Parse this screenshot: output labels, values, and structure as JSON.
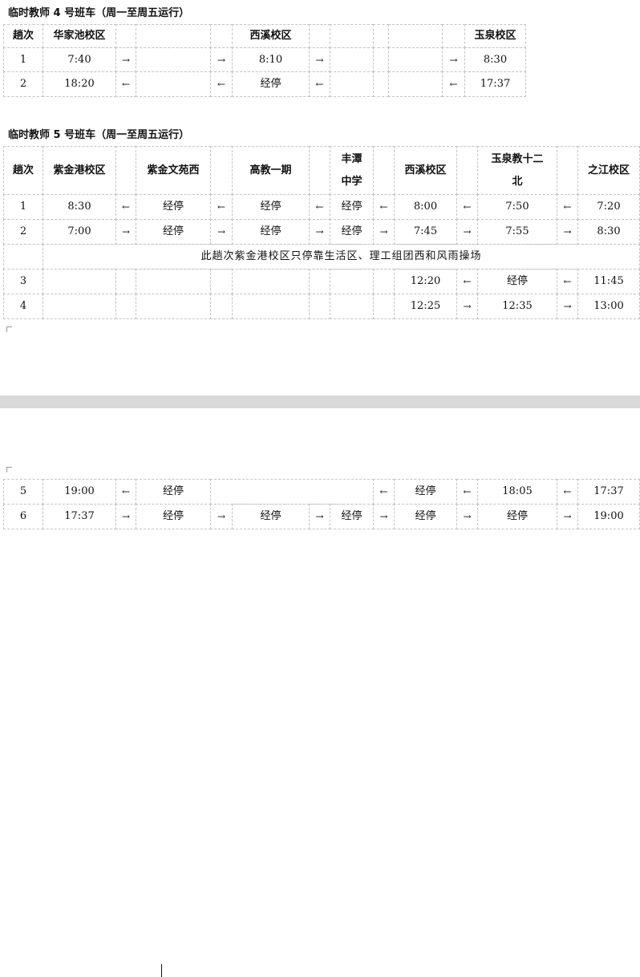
{
  "bus4": {
    "title": "临时教师 4 号班车（周一至周五运行）",
    "header": {
      "trip": "趟次",
      "stop1": "华家池校区",
      "stop2": "西溪校区",
      "stop3": "玉泉校区"
    },
    "rows": [
      {
        "trip": "1",
        "stop1": "7:40",
        "a1": "→",
        "a2": "→",
        "stop2": "8:10",
        "a3": "→",
        "a4": "→",
        "stop3": "8:30"
      },
      {
        "trip": "2",
        "stop1": "18:20",
        "a1": "←",
        "a2": "←",
        "stop2": "经停",
        "a3": "←",
        "a4": "←",
        "stop3": "17:37"
      }
    ]
  },
  "bus5": {
    "title": "临时教师 5 号班车（周一至周五运行）",
    "header": {
      "trip": "趟次",
      "s1": "紫金港校区",
      "s2": "紫金文苑西",
      "s3": "高教一期",
      "s4_l1": "丰潭",
      "s4_l2": "中学",
      "s5": "西溪校区",
      "s6_l1": "玉泉教十二",
      "s6_l2": "北",
      "s7": "之江校区"
    },
    "rows": [
      {
        "trip": "1",
        "s1": "8:30",
        "a1": "←",
        "s2": "经停",
        "a2": "←",
        "s3": "经停",
        "a3": "←",
        "s4": "经停",
        "a4": "←",
        "s5": "8:00",
        "a5": "←",
        "s6": "7:50",
        "a6": "←",
        "s7": "7:20"
      },
      {
        "trip": "2",
        "s1": "7:00",
        "a1": "→",
        "s2": "经停",
        "a2": "→",
        "s3": "经停",
        "a3": "→",
        "s4": "经停",
        "a4": "→",
        "s5": "7:45",
        "a5": "→",
        "s6": "7:55",
        "a6": "→",
        "s7": "8:30"
      }
    ],
    "note": "此趟次紫金港校区只停靠生活区、理工组团西和风雨操场",
    "rows_b": [
      {
        "trip": "3",
        "s5": "12:20",
        "a5": "←",
        "s6": "经停",
        "a6": "←",
        "s7": "11:45"
      },
      {
        "trip": "4",
        "s5": "12:25",
        "a5": "→",
        "s6": "12:35",
        "a6": "→",
        "s7": "13:00"
      }
    ],
    "rows_c": [
      {
        "trip": "5",
        "s1": "19:00",
        "a1": "←",
        "s2": "经停",
        "a4": "←",
        "s5": "经停",
        "a5": "←",
        "s6": "18:05",
        "a6": "←",
        "s7": "17:37"
      },
      {
        "trip": "6",
        "s1": "17:37",
        "a1": "→",
        "s2": "经停",
        "a2": "→",
        "s3": "经停",
        "a3": "→",
        "s4": "经停",
        "a4": "→",
        "s5": "经停",
        "a5": "→",
        "s6": "经停",
        "a6": "→",
        "s7": "19:00"
      }
    ]
  }
}
